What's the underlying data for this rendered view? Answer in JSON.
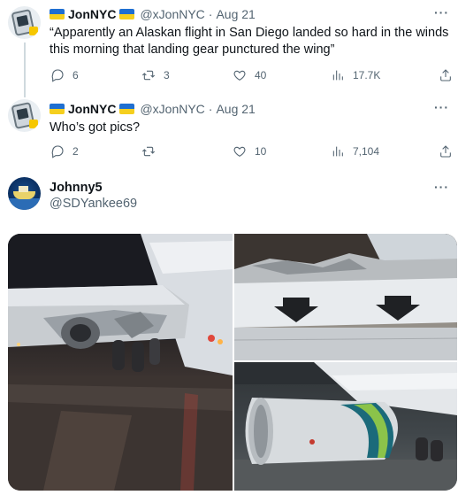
{
  "tweet1": {
    "name": "JonNYC",
    "handle": "@xJonNYC",
    "separator": "·",
    "date": "Aug 21",
    "more": "···",
    "text": "“Apparently an Alaskan flight in San Diego landed so hard in the winds this morning that landing gear punctured the wing”",
    "replies": "6",
    "reposts": "3",
    "likes": "40",
    "views": "17.7K"
  },
  "tweet2": {
    "name": "JonNYC",
    "handle": "@xJonNYC",
    "separator": "·",
    "date": "Aug 21",
    "more": "···",
    "text": "Who’s got pics?",
    "replies": "2",
    "reposts": "",
    "likes": "10",
    "views": "7,104"
  },
  "tweet3": {
    "name": "Johnny5",
    "handle": "@SDYankee69",
    "more": "···"
  },
  "colors": {
    "text": "#0f1419",
    "secondary": "#536471",
    "flag_blue": "#1f6fd1",
    "flag_yellow": "#f5cf1e",
    "thread_line": "#cfd9de"
  },
  "icons": {
    "reply": "speech-bubble",
    "repost": "two-arrows-loop",
    "like": "heart",
    "views": "bar-chart",
    "share": "arrow-up-from-tray"
  }
}
